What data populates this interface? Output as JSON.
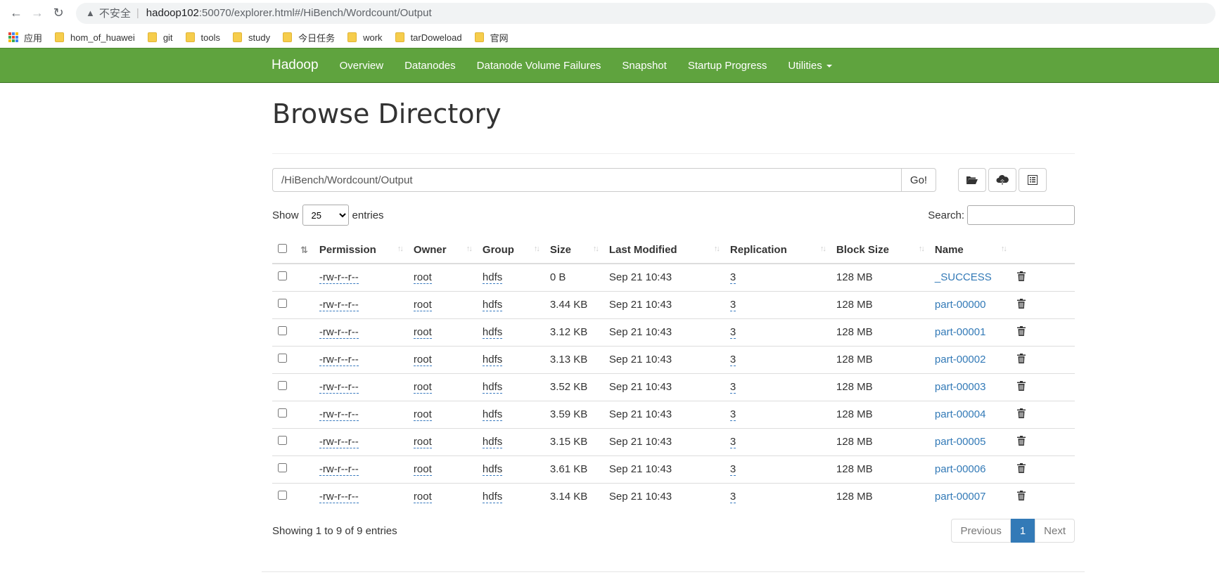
{
  "browser": {
    "insecure_label": "不安全",
    "url_host": "hadoop102",
    "url_rest": ":50070/explorer.html#/HiBench/Wordcount/Output",
    "bookmarks": [
      "应用",
      "hom_of_huawei",
      "git",
      "tools",
      "study",
      "今日任务",
      "work",
      "tarDoweload",
      "官网"
    ]
  },
  "nav": {
    "brand": "Hadoop",
    "links": [
      "Overview",
      "Datanodes",
      "Datanode Volume Failures",
      "Snapshot",
      "Startup Progress",
      "Utilities"
    ]
  },
  "page": {
    "title": "Browse Directory",
    "path_value": "/HiBench/Wordcount/Output",
    "go_label": "Go!",
    "show_label": "Show",
    "entries_value": "25",
    "entries_label": "entries",
    "search_label": "Search:"
  },
  "table": {
    "headers": [
      "Permission",
      "Owner",
      "Group",
      "Size",
      "Last Modified",
      "Replication",
      "Block Size",
      "Name"
    ],
    "rows": [
      {
        "perm": "-rw-r--r--",
        "owner": "root",
        "group": "hdfs",
        "size": "0 B",
        "modified": "Sep 21 10:43",
        "repl": "3",
        "block": "128 MB",
        "name": "_SUCCESS"
      },
      {
        "perm": "-rw-r--r--",
        "owner": "root",
        "group": "hdfs",
        "size": "3.44 KB",
        "modified": "Sep 21 10:43",
        "repl": "3",
        "block": "128 MB",
        "name": "part-00000"
      },
      {
        "perm": "-rw-r--r--",
        "owner": "root",
        "group": "hdfs",
        "size": "3.12 KB",
        "modified": "Sep 21 10:43",
        "repl": "3",
        "block": "128 MB",
        "name": "part-00001"
      },
      {
        "perm": "-rw-r--r--",
        "owner": "root",
        "group": "hdfs",
        "size": "3.13 KB",
        "modified": "Sep 21 10:43",
        "repl": "3",
        "block": "128 MB",
        "name": "part-00002"
      },
      {
        "perm": "-rw-r--r--",
        "owner": "root",
        "group": "hdfs",
        "size": "3.52 KB",
        "modified": "Sep 21 10:43",
        "repl": "3",
        "block": "128 MB",
        "name": "part-00003"
      },
      {
        "perm": "-rw-r--r--",
        "owner": "root",
        "group": "hdfs",
        "size": "3.59 KB",
        "modified": "Sep 21 10:43",
        "repl": "3",
        "block": "128 MB",
        "name": "part-00004"
      },
      {
        "perm": "-rw-r--r--",
        "owner": "root",
        "group": "hdfs",
        "size": "3.15 KB",
        "modified": "Sep 21 10:43",
        "repl": "3",
        "block": "128 MB",
        "name": "part-00005"
      },
      {
        "perm": "-rw-r--r--",
        "owner": "root",
        "group": "hdfs",
        "size": "3.61 KB",
        "modified": "Sep 21 10:43",
        "repl": "3",
        "block": "128 MB",
        "name": "part-00006"
      },
      {
        "perm": "-rw-r--r--",
        "owner": "root",
        "group": "hdfs",
        "size": "3.14 KB",
        "modified": "Sep 21 10:43",
        "repl": "3",
        "block": "128 MB",
        "name": "part-00007"
      }
    ]
  },
  "footer": {
    "info": "Showing 1 to 9 of 9 entries",
    "prev": "Previous",
    "page": "1",
    "next": "Next"
  },
  "colors": {
    "navbar": "#5fa33e",
    "link": "#337ab7",
    "active_page": "#337ab7"
  }
}
